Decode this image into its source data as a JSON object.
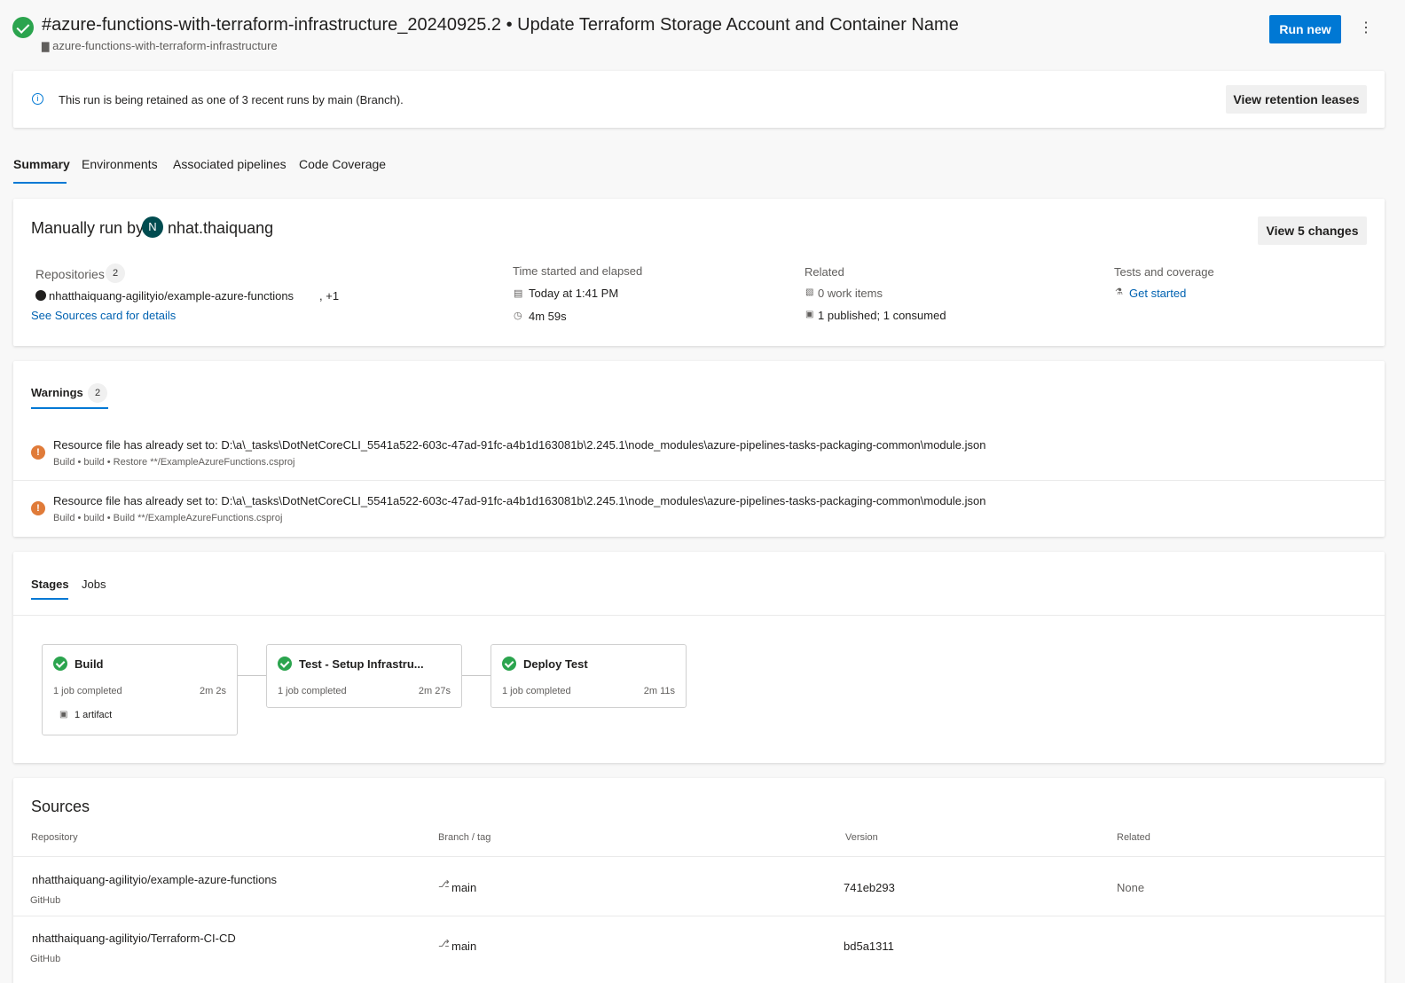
{
  "header": {
    "title": "#azure-functions-with-terraform-infrastructure_20240925.2 • Update Terraform Storage Account and Container Name",
    "pipeline_name": "azure-functions-with-terraform-infrastructure",
    "run_new_label": "Run new",
    "more_icon": "more-vertical-icon"
  },
  "retention": {
    "message": "This run is being retained as one of 3 recent runs by main (Branch).",
    "button_label": "View retention leases"
  },
  "tabs": [
    "Summary",
    "Environments",
    "Associated pipelines",
    "Code Coverage"
  ],
  "summary": {
    "run_by_prefix": "Manually run by",
    "avatar_initial": "N",
    "user": "nhat.thaiquang",
    "view_changes_label": "View 5 changes",
    "repositories_label": "Repositories",
    "repositories_count": "2",
    "repo_name": "nhatthaiquang-agilityio/example-azure-functions",
    "repo_more": ", +1",
    "sources_link": "See Sources card for details",
    "time_label": "Time started and elapsed",
    "started": "Today at 1:41 PM",
    "elapsed": "4m 59s",
    "related_label": "Related",
    "work_items": "0 work items",
    "artifacts": "1 published; 1 consumed",
    "tests_label": "Tests and coverage",
    "tests_link": "Get started"
  },
  "warnings": {
    "tab_label": "Warnings",
    "count": "2",
    "items": [
      {
        "message": "Resource file has already set to: D:\\a\\_tasks\\DotNetCoreCLI_5541a522-603c-47ad-91fc-a4b1d163081b\\2.245.1\\node_modules\\azure-pipelines-tasks-packaging-common\\module.json",
        "path": "Build • build • Restore **/ExampleAzureFunctions.csproj"
      },
      {
        "message": "Resource file has already set to: D:\\a\\_tasks\\DotNetCoreCLI_5541a522-603c-47ad-91fc-a4b1d163081b\\2.245.1\\node_modules\\azure-pipelines-tasks-packaging-common\\module.json",
        "path": "Build • build • Build **/ExampleAzureFunctions.csproj"
      }
    ]
  },
  "stages_card": {
    "tabs": [
      "Stages",
      "Jobs"
    ],
    "stages": [
      {
        "name": "Build",
        "status": "1 job completed",
        "duration": "2m 2s",
        "artifact": "1 artifact"
      },
      {
        "name": "Test - Setup Infrastru...",
        "status": "1 job completed",
        "duration": "2m 27s"
      },
      {
        "name": "Deploy Test",
        "status": "1 job completed",
        "duration": "2m 11s"
      }
    ]
  },
  "sources": {
    "title": "Sources",
    "columns": [
      "Repository",
      "Branch / tag",
      "Version",
      "Related"
    ],
    "rows": [
      {
        "repo": "nhatthaiquang-agilityio/example-azure-functions",
        "provider": "GitHub",
        "branch": "main",
        "version": "741eb293",
        "related": "None"
      },
      {
        "repo": "nhatthaiquang-agilityio/Terraform-CI-CD",
        "provider": "GitHub",
        "branch": "main",
        "version": "bd5a1311",
        "related": ""
      }
    ]
  },
  "colors": {
    "accent": "#0078d4",
    "success": "#2ba44e",
    "warning": "#e07b39",
    "avatar": "#004c50"
  }
}
